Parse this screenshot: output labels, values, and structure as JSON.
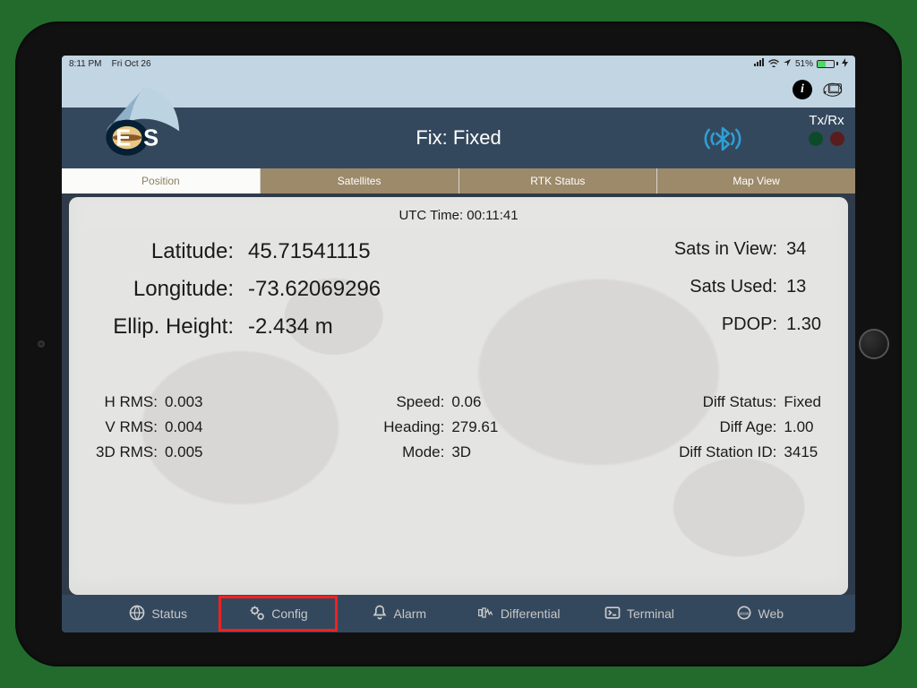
{
  "statusbar": {
    "time": "8:11 PM",
    "date": "Fri Oct 26",
    "battery_pct": "51%"
  },
  "header": {
    "fix_label": "Fix:",
    "fix_value": "Fixed",
    "txrx_label": "Tx/Rx",
    "logo_text": "EOS"
  },
  "tabs": [
    {
      "label": "Position",
      "active": true
    },
    {
      "label": "Satellites",
      "active": false
    },
    {
      "label": "RTK Status",
      "active": false
    },
    {
      "label": "Map View",
      "active": false
    }
  ],
  "position": {
    "utc_label": "UTC Time:",
    "utc_value": "00:11:41",
    "left": [
      {
        "label": "Latitude:",
        "value": "45.71541115"
      },
      {
        "label": "Longitude:",
        "value": "-73.62069296"
      },
      {
        "label": "Ellip. Height:",
        "value": "-2.434 m"
      }
    ],
    "right": [
      {
        "label": "Sats in View:",
        "value": "34"
      },
      {
        "label": "Sats Used:",
        "value": "13"
      },
      {
        "label": "PDOP:",
        "value": "1.30"
      }
    ],
    "bottom_left": [
      {
        "label": "H RMS:",
        "value": "0.003"
      },
      {
        "label": "V RMS:",
        "value": "0.004"
      },
      {
        "label": "3D RMS:",
        "value": "0.005"
      }
    ],
    "bottom_mid": [
      {
        "label": "Speed:",
        "value": "0.06"
      },
      {
        "label": "Heading:",
        "value": "279.61"
      },
      {
        "label": "Mode:",
        "value": "3D"
      }
    ],
    "bottom_right": [
      {
        "label": "Diff Status:",
        "value": "Fixed"
      },
      {
        "label": "Diff Age:",
        "value": "1.00"
      },
      {
        "label": "Diff Station ID:",
        "value": "3415"
      }
    ]
  },
  "bottomnav": [
    {
      "label": "Status",
      "icon": "globe-icon"
    },
    {
      "label": "Config",
      "icon": "gears-icon",
      "highlight": true
    },
    {
      "label": "Alarm",
      "icon": "bell-icon"
    },
    {
      "label": "Differential",
      "icon": "differential-icon"
    },
    {
      "label": "Terminal",
      "icon": "terminal-icon"
    },
    {
      "label": "Web",
      "icon": "web-icon"
    }
  ]
}
